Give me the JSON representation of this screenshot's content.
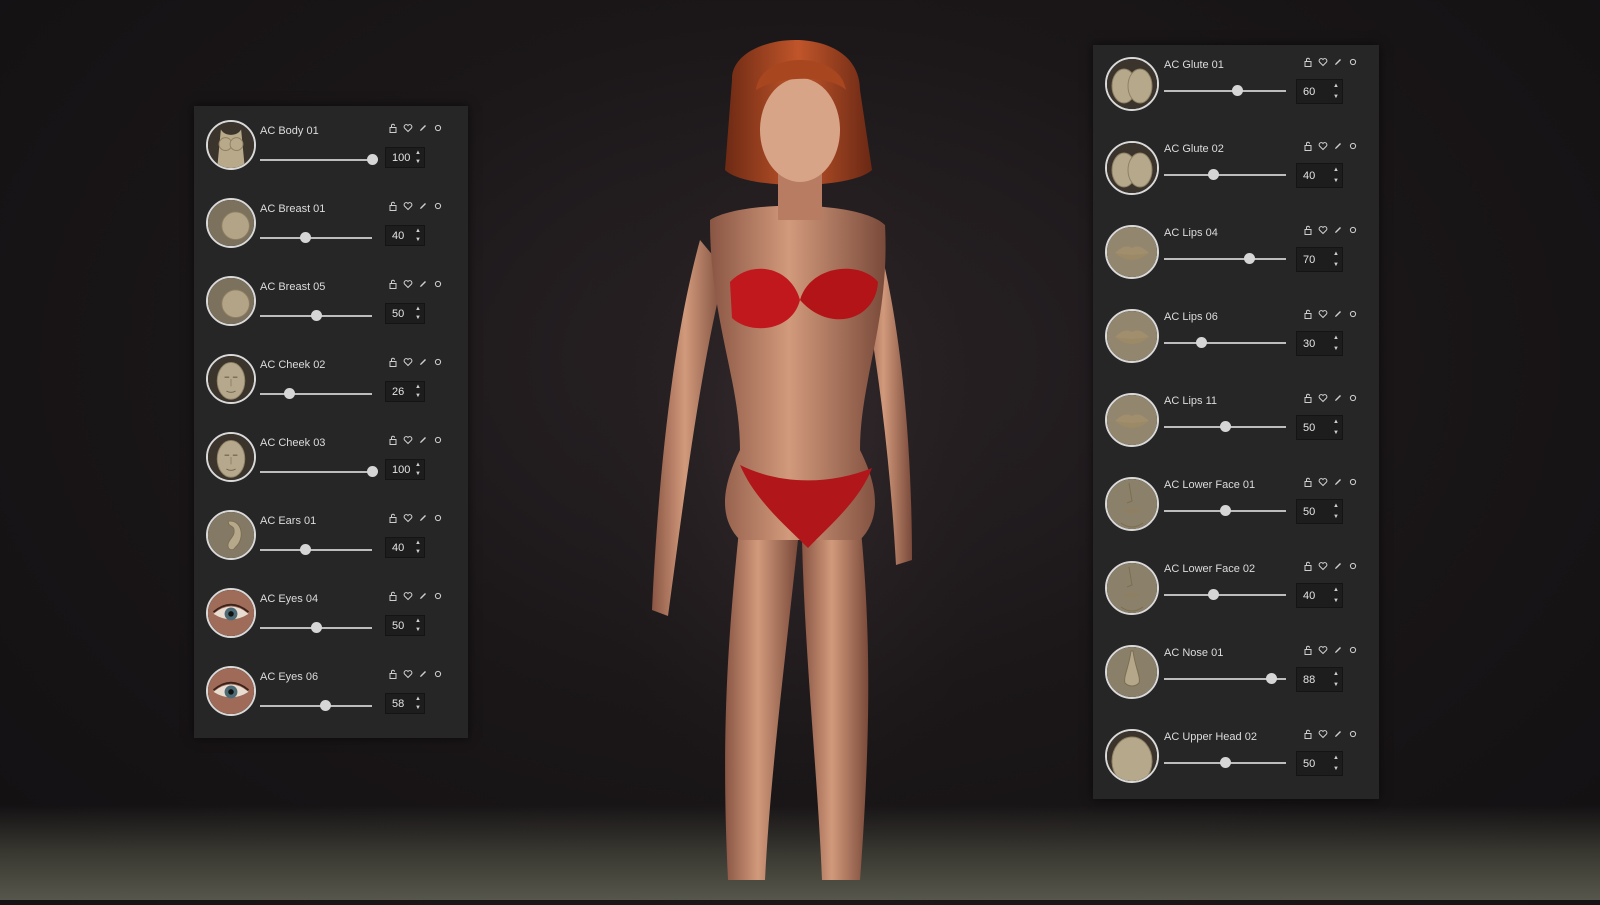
{
  "panels": {
    "left": [
      {
        "label": "AC Body 01",
        "value": 100,
        "thumb": "body",
        "thumb_color": "#b8a98b"
      },
      {
        "label": "AC Breast 01",
        "value": 40,
        "thumb": "breast",
        "thumb_color": "#b3a487"
      },
      {
        "label": "AC Breast 05",
        "value": 50,
        "thumb": "breast",
        "thumb_color": "#b3a487"
      },
      {
        "label": "AC Cheek 02",
        "value": 26,
        "thumb": "face",
        "thumb_color": "#b5a88c"
      },
      {
        "label": "AC Cheek 03",
        "value": 100,
        "thumb": "face",
        "thumb_color": "#b5a88c"
      },
      {
        "label": "AC Ears 01",
        "value": 40,
        "thumb": "ear",
        "thumb_color": "#b6a88a"
      },
      {
        "label": "AC Eyes 04",
        "value": 50,
        "thumb": "eye",
        "thumb_color": "#a06c5a"
      },
      {
        "label": "AC Eyes 06",
        "value": 58,
        "thumb": "eye",
        "thumb_color": "#9f6a58"
      }
    ],
    "right": [
      {
        "label": "AC Glute 01",
        "value": 60,
        "thumb": "glute",
        "thumb_color": "#b6a98b"
      },
      {
        "label": "AC Glute 02",
        "value": 40,
        "thumb": "glute",
        "thumb_color": "#b6a98b"
      },
      {
        "label": "AC Lips 04",
        "value": 70,
        "thumb": "lips",
        "thumb_color": "#b8aa8c"
      },
      {
        "label": "AC Lips 06",
        "value": 30,
        "thumb": "lips",
        "thumb_color": "#b8aa8c"
      },
      {
        "label": "AC Lips 11",
        "value": 50,
        "thumb": "lips",
        "thumb_color": "#b8aa8c"
      },
      {
        "label": "AC Lower Face 01",
        "value": 50,
        "thumb": "lowerface",
        "thumb_color": "#b7a98a"
      },
      {
        "label": "AC Lower Face 02",
        "value": 40,
        "thumb": "lowerface",
        "thumb_color": "#b7a98a"
      },
      {
        "label": "AC Nose 01",
        "value": 88,
        "thumb": "nose",
        "thumb_color": "#b5a789"
      },
      {
        "label": "AC Upper Head 02",
        "value": 50,
        "thumb": "head",
        "thumb_color": "#b6a88a"
      }
    ]
  },
  "slider_range": [
    0,
    100
  ],
  "row_icons": [
    "lock-icon",
    "heart-icon",
    "pencil-icon",
    "reset-circle-icon"
  ],
  "spinner": {
    "up": "▲",
    "down": "▼"
  },
  "colors": {
    "background": "#1b1719",
    "panel": "#262626",
    "bikini": "#c0181c",
    "skin": "#c98a6e",
    "hair": "#9a3e1e"
  }
}
